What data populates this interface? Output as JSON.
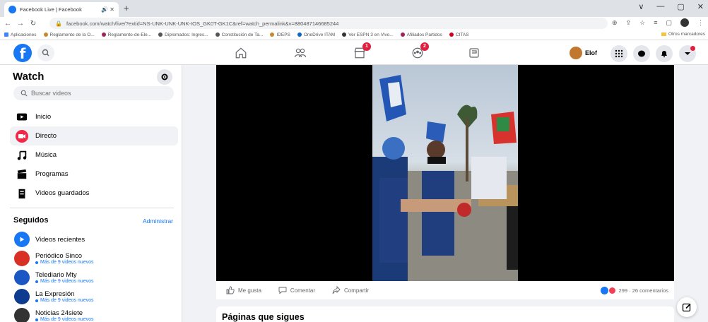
{
  "browser": {
    "tab_title": "Facebook Live | Facebook",
    "tab_controls": "🔊 ✕",
    "new_tab": "+",
    "window_controls": [
      "∨",
      "—",
      "▢",
      "✕"
    ],
    "url": "facebook.com/watch/live/?extid=NS-UNK-UNK-UNK-IOS_GK0T-GK1C&ref=watch_permalink&v=880487146685244",
    "bookmarks": [
      {
        "label": "Aplicaciones",
        "color": "#4285f4"
      },
      {
        "label": "Reglamento de la O...",
        "color": "#c58a2a"
      },
      {
        "label": "Reglamento-de-Ele...",
        "color": "#a0245a"
      },
      {
        "label": "Diplomados: Ingres...",
        "color": "#555555"
      },
      {
        "label": "Constitución de Ta...",
        "color": "#555555"
      },
      {
        "label": "IDEPS",
        "color": "#c58a2a"
      },
      {
        "label": "OneDrive ITAM",
        "color": "#0a66c2"
      },
      {
        "label": "Ver ESPN 3 en Vivo...",
        "color": "#333333"
      },
      {
        "label": "Afiliados Partidos",
        "color": "#a0245a"
      },
      {
        "label": "CITAS",
        "color": "#d0021b"
      }
    ],
    "other_bookmarks": "Otros marcadores"
  },
  "fb": {
    "logo": "f",
    "profile_name": "Elof",
    "nav_badges": {
      "marketplace": "1",
      "groups": "2"
    }
  },
  "sidebar": {
    "title": "Watch",
    "search_placeholder": "Buscar videos",
    "items": [
      {
        "label": "Inicio",
        "icon": "tv-icon"
      },
      {
        "label": "Directo",
        "icon": "live-icon"
      },
      {
        "label": "Música",
        "icon": "music-icon"
      },
      {
        "label": "Programas",
        "icon": "clapper-icon"
      },
      {
        "label": "Videos guardados",
        "icon": "bookmark-icon"
      }
    ],
    "following_title": "Seguidos",
    "admin_link": "Administrar",
    "following": [
      {
        "name": "Videos recientes",
        "sub": "",
        "color": "#1877f2"
      },
      {
        "name": "Periódico Sinco",
        "sub": "Más de 9 videos nuevos",
        "color": "#d93025"
      },
      {
        "name": "Telediario Mty",
        "sub": "Más de 9 videos nuevos",
        "color": "#1a56c4"
      },
      {
        "name": "La Expresión",
        "sub": "Más de 9 videos nuevos",
        "color": "#0d3b8f"
      },
      {
        "name": "Noticias 24siete",
        "sub": "Más de 9 videos nuevos",
        "color": "#333333"
      }
    ]
  },
  "post": {
    "like": "Me gusta",
    "comment": "Comentar",
    "share": "Compartir",
    "reactions": "299 · 26 comentarios"
  },
  "pages_section_title": "Páginas que sigues"
}
